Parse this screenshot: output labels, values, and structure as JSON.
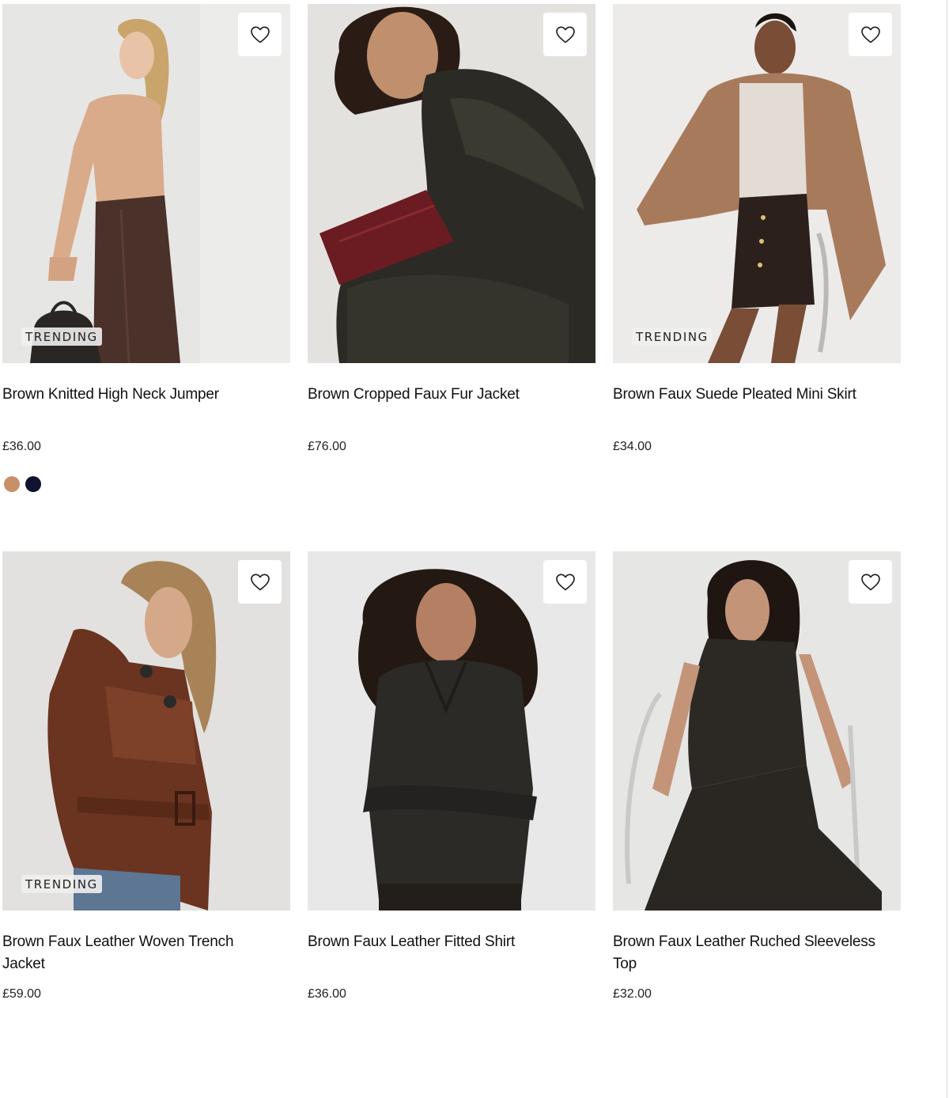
{
  "labels": {
    "wishlist_icon": "heart-outline-icon"
  },
  "colors": {
    "text": "#111111",
    "badge_bg": "#f0f0ee",
    "swatch_tan": "#c8906a",
    "swatch_navy": "#0f1330"
  },
  "products": [
    {
      "name": "Brown Knitted High Neck Jumper",
      "price": "£36.00",
      "badge": "TRENDING",
      "swatches": [
        "tan",
        "navy"
      ]
    },
    {
      "name": "Brown Cropped Faux Fur Jacket",
      "price": "£76.00",
      "badge": ""
    },
    {
      "name": "Brown Faux Suede Pleated Mini Skirt",
      "price": "£34.00",
      "badge": "TRENDING"
    },
    {
      "name": "Brown Faux Leather Woven Trench Jacket",
      "price": "£59.00",
      "badge": "TRENDING"
    },
    {
      "name": "Brown Faux Leather Fitted Shirt",
      "price": "£36.00",
      "badge": ""
    },
    {
      "name": "Brown Faux Leather Ruched Sleeveless Top",
      "price": "£32.00",
      "badge": ""
    }
  ]
}
